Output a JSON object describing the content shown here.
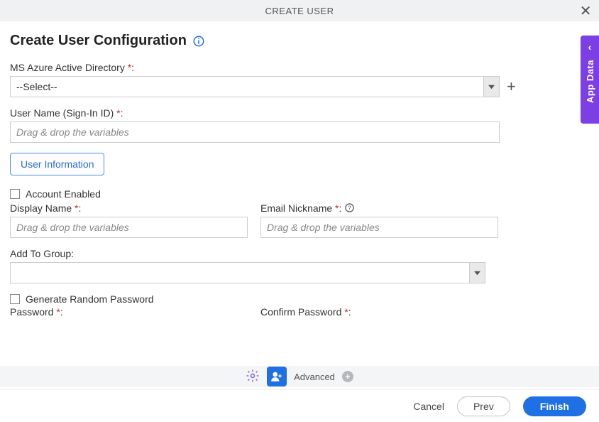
{
  "header": {
    "title": "CREATE USER"
  },
  "page": {
    "title": "Create User Configuration"
  },
  "fields": {
    "azure_ad": {
      "label": "MS Azure Active Directory ",
      "required": "*",
      "colon": ":",
      "value": "--Select--"
    },
    "user_name": {
      "label": "User Name (Sign-In ID) ",
      "required": "*",
      "colon": ":",
      "placeholder": "Drag & drop the variables"
    },
    "tab_user_info": "User Information",
    "account_enabled": "Account Enabled",
    "display_name": {
      "label": "Display Name ",
      "required": "*",
      "colon": ":",
      "placeholder": "Drag & drop the variables"
    },
    "email_nickname": {
      "label": "Email Nickname ",
      "required": "*",
      "colon": ": ",
      "placeholder": "Drag & drop the variables"
    },
    "add_to_group": {
      "label": "Add To Group:"
    },
    "gen_pw": "Generate Random Password",
    "password": {
      "label": "Password ",
      "required": "*",
      "colon": ":"
    },
    "confirm_password": {
      "label": "Confirm Password ",
      "required": "*",
      "colon": ":"
    }
  },
  "midbar": {
    "advanced": "Advanced"
  },
  "footer": {
    "cancel": "Cancel",
    "prev": "Prev",
    "finish": "Finish"
  },
  "side": {
    "label": "App Data"
  }
}
